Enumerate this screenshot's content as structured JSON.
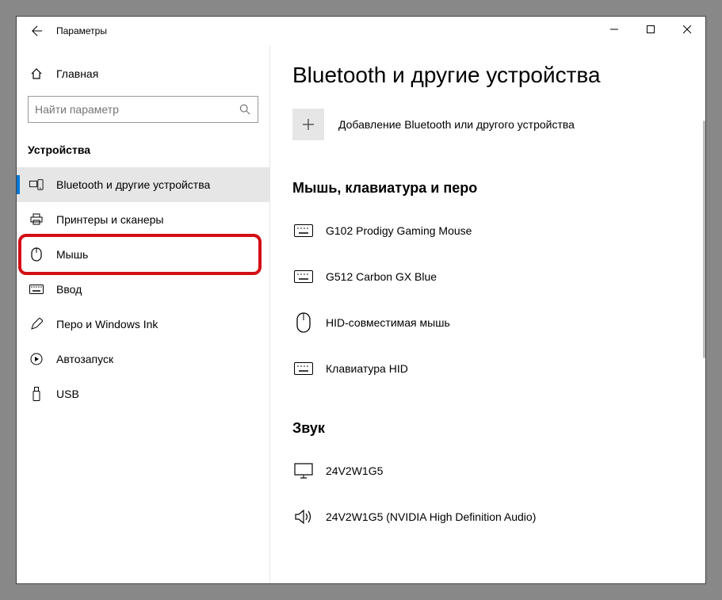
{
  "titlebar": {
    "app_title": "Параметры"
  },
  "sidebar": {
    "home_label": "Главная",
    "search_placeholder": "Найти параметр",
    "section_title": "Устройства",
    "items": [
      {
        "label": "Bluetooth и другие устройства",
        "icon": "devices",
        "selected": true,
        "highlight": false
      },
      {
        "label": "Принтеры и сканеры",
        "icon": "printer",
        "selected": false,
        "highlight": false
      },
      {
        "label": "Мышь",
        "icon": "mouse",
        "selected": false,
        "highlight": true
      },
      {
        "label": "Ввод",
        "icon": "keyboard",
        "selected": false,
        "highlight": false
      },
      {
        "label": "Перо и Windows Ink",
        "icon": "pen",
        "selected": false,
        "highlight": false
      },
      {
        "label": "Автозапуск",
        "icon": "autoplay",
        "selected": false,
        "highlight": false
      },
      {
        "label": "USB",
        "icon": "usb",
        "selected": false,
        "highlight": false
      }
    ]
  },
  "content": {
    "page_title": "Bluetooth и другие устройства",
    "add_device_label": "Добавление Bluetooth или другого устройства",
    "groups": [
      {
        "title": "Мышь, клавиатура и перо",
        "devices": [
          {
            "label": "G102 Prodigy Gaming Mouse",
            "icon": "keyboard"
          },
          {
            "label": "G512 Carbon GX Blue",
            "icon": "keyboard"
          },
          {
            "label": "HID-совместимая мышь",
            "icon": "mouse"
          },
          {
            "label": "Клавиатура HID",
            "icon": "keyboard"
          }
        ]
      },
      {
        "title": "Звук",
        "devices": [
          {
            "label": "24V2W1G5",
            "icon": "monitor"
          },
          {
            "label": "24V2W1G5 (NVIDIA High Definition Audio)",
            "icon": "speaker"
          }
        ]
      }
    ]
  }
}
